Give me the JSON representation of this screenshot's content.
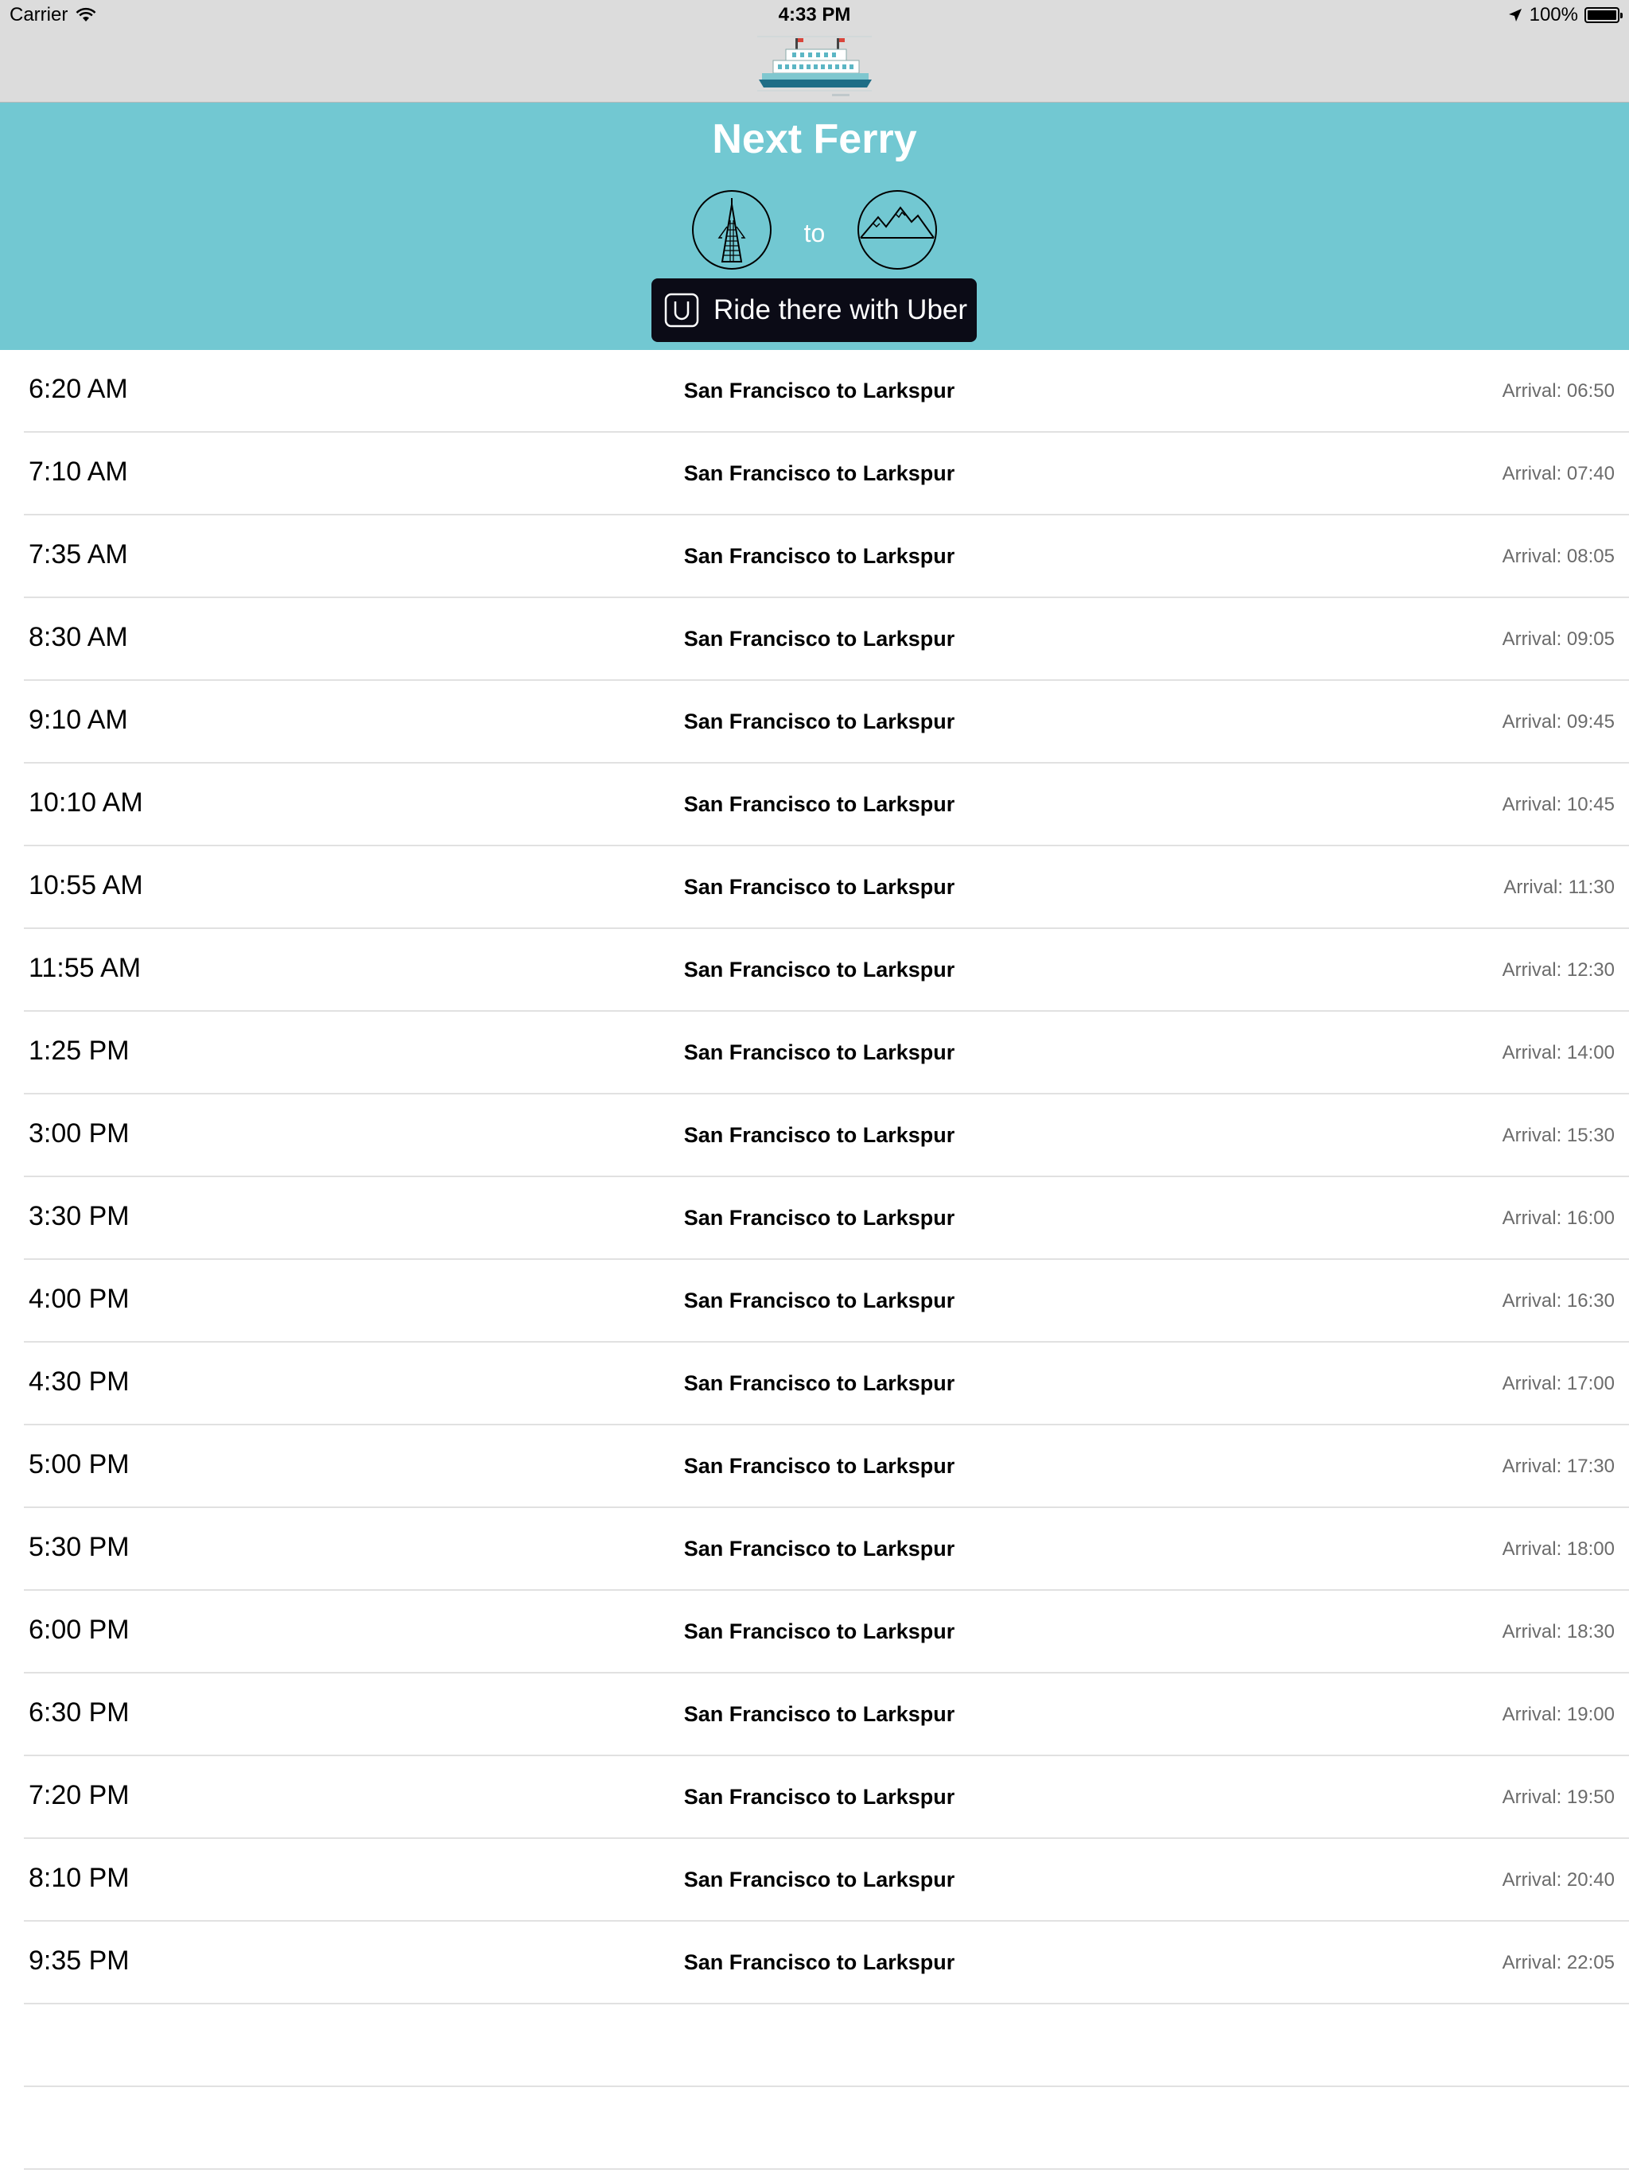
{
  "status_bar": {
    "carrier": "Carrier",
    "time": "4:33 PM",
    "battery_text": "100%",
    "battery_level": 1.0
  },
  "header": {
    "title": "Next Ferry",
    "to_label": "to",
    "origin_icon": "transamerica-pyramid-icon",
    "destination_icon": "mountains-icon",
    "uber_button_label": "Ride there with Uber",
    "background_color": "#72c8d2",
    "uber_button_color": "#0b0b16"
  },
  "departures": [
    {
      "time": "6:20 AM",
      "route": "San Francisco to Larkspur",
      "arrival": "Arrival: 06:50"
    },
    {
      "time": "7:10 AM",
      "route": "San Francisco to Larkspur",
      "arrival": "Arrival: 07:40"
    },
    {
      "time": "7:35 AM",
      "route": "San Francisco to Larkspur",
      "arrival": "Arrival: 08:05"
    },
    {
      "time": "8:30 AM",
      "route": "San Francisco to Larkspur",
      "arrival": "Arrival: 09:05"
    },
    {
      "time": "9:10 AM",
      "route": "San Francisco to Larkspur",
      "arrival": "Arrival: 09:45"
    },
    {
      "time": "10:10 AM",
      "route": "San Francisco to Larkspur",
      "arrival": "Arrival: 10:45"
    },
    {
      "time": "10:55 AM",
      "route": "San Francisco to Larkspur",
      "arrival": "Arrival: 11:30"
    },
    {
      "time": "11:55 AM",
      "route": "San Francisco to Larkspur",
      "arrival": "Arrival: 12:30"
    },
    {
      "time": "1:25 PM",
      "route": "San Francisco to Larkspur",
      "arrival": "Arrival: 14:00"
    },
    {
      "time": "3:00 PM",
      "route": "San Francisco to Larkspur",
      "arrival": "Arrival: 15:30"
    },
    {
      "time": "3:30 PM",
      "route": "San Francisco to Larkspur",
      "arrival": "Arrival: 16:00"
    },
    {
      "time": "4:00 PM",
      "route": "San Francisco to Larkspur",
      "arrival": "Arrival: 16:30"
    },
    {
      "time": "4:30 PM",
      "route": "San Francisco to Larkspur",
      "arrival": "Arrival: 17:00"
    },
    {
      "time": "5:00 PM",
      "route": "San Francisco to Larkspur",
      "arrival": "Arrival: 17:30"
    },
    {
      "time": "5:30 PM",
      "route": "San Francisco to Larkspur",
      "arrival": "Arrival: 18:00"
    },
    {
      "time": "6:00 PM",
      "route": "San Francisco to Larkspur",
      "arrival": "Arrival: 18:30"
    },
    {
      "time": "6:30 PM",
      "route": "San Francisco to Larkspur",
      "arrival": "Arrival: 19:00"
    },
    {
      "time": "7:20 PM",
      "route": "San Francisco to Larkspur",
      "arrival": "Arrival: 19:50"
    },
    {
      "time": "8:10 PM",
      "route": "San Francisco to Larkspur",
      "arrival": "Arrival: 20:40"
    },
    {
      "time": "9:35 PM",
      "route": "San Francisco to Larkspur",
      "arrival": "Arrival: 22:05"
    },
    {
      "time": "",
      "route": "",
      "arrival": ""
    },
    {
      "time": "",
      "route": "",
      "arrival": ""
    }
  ]
}
